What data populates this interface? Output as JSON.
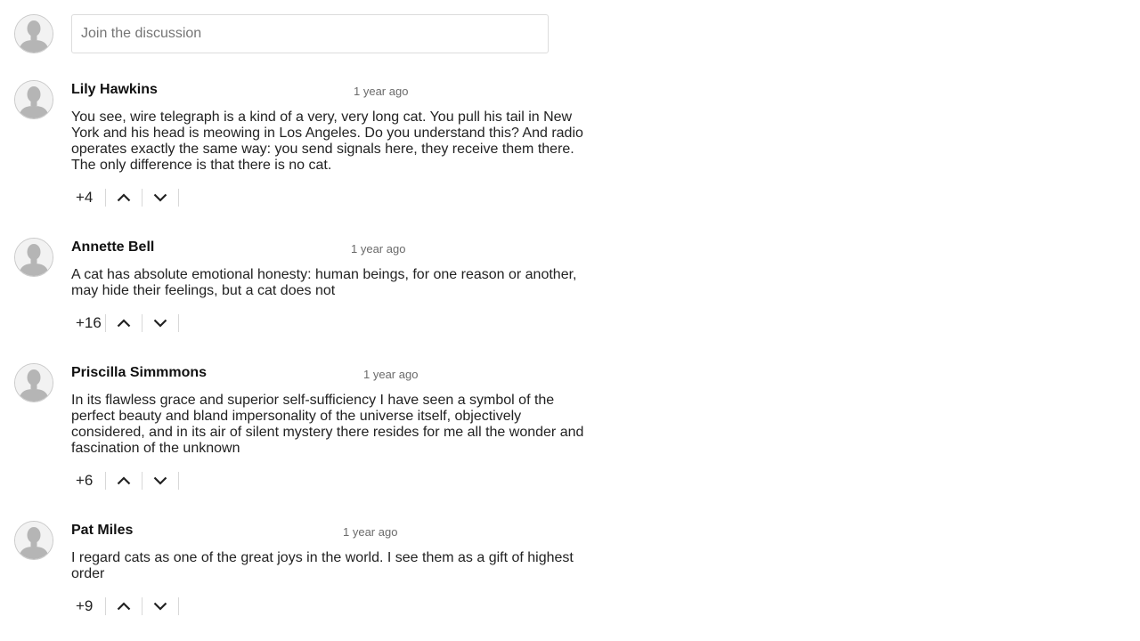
{
  "compose": {
    "placeholder": "Join the discussion"
  },
  "comments": [
    {
      "author": "Lily Hawkins",
      "time": "1 year ago",
      "text": "You see, wire telegraph is a kind of a very, very long cat. You pull his tail in New York and his head is meowing in Los Angeles. Do you understand this? And radio operates exactly the same way: you send signals here, they receive them there. The only difference is that there is no cat.",
      "score": "+4"
    },
    {
      "author": "Annette Bell",
      "time": "1 year ago",
      "text": "A cat has absolute emotional honesty: human beings, for one reason or another, may hide their feelings, but a cat does not",
      "score": "+16"
    },
    {
      "author": "Priscilla Simmmons",
      "time": "1 year ago",
      "text": "In its flawless grace and superior self-sufficiency I have seen a symbol of the perfect beauty and bland impersonality of the universe itself, objectively considered, and in its air of silent mystery there resides for me all the wonder and fascination of the unknown",
      "score": "+6"
    },
    {
      "author": "Pat Miles",
      "time": "1 year ago",
      "text": "I regard cats as one of the great joys in the world. I see them as a gift of highest order",
      "score": "+9"
    }
  ],
  "icons": {
    "avatar": "user-silhouette-icon",
    "upvote": "chevron-up-icon",
    "downvote": "chevron-down-icon"
  }
}
